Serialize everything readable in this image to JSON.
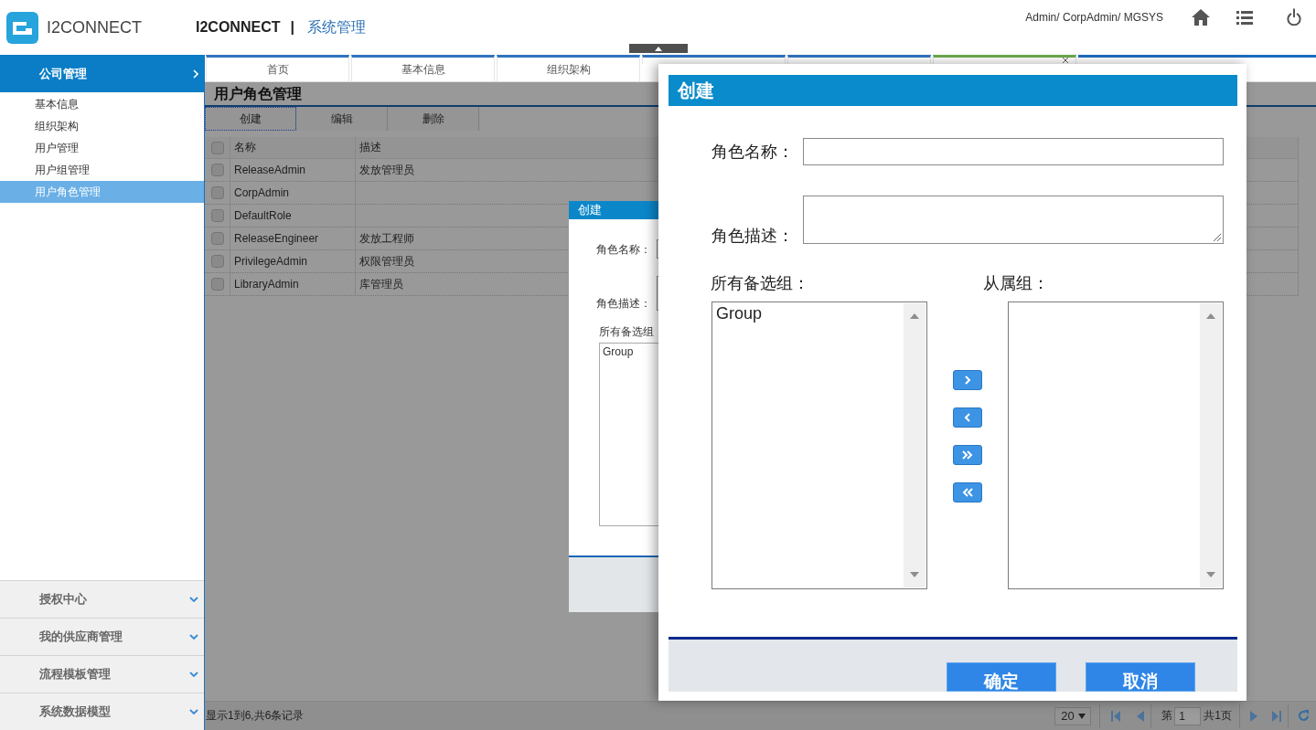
{
  "header": {
    "brand": "I2CONNECT",
    "app": "I2CONNECT",
    "separator": "|",
    "module": "系统管理",
    "user": "Admin/ CorpAdmin/ MGSYS"
  },
  "sidebar": {
    "sections": [
      {
        "label": "公司管理",
        "expanded": true,
        "items": [
          {
            "label": "基本信息",
            "selected": false
          },
          {
            "label": "组织架构",
            "selected": false
          },
          {
            "label": "用户管理",
            "selected": false
          },
          {
            "label": "用户组管理",
            "selected": false
          },
          {
            "label": "用户角色管理",
            "selected": true
          }
        ]
      },
      {
        "label": "授权中心",
        "expanded": false
      },
      {
        "label": "我的供应商管理",
        "expanded": false
      },
      {
        "label": "流程模板管理",
        "expanded": false
      },
      {
        "label": "系统数据模型",
        "expanded": false
      }
    ]
  },
  "tabs": [
    {
      "label": "首页",
      "selected": false,
      "closable": false
    },
    {
      "label": "基本信息",
      "selected": false,
      "closable": false
    },
    {
      "label": "组织架构",
      "selected": false,
      "closable": false
    },
    {
      "selected": false,
      "closable": false
    },
    {
      "selected": false,
      "closable": false
    },
    {
      "selected": true,
      "closable": true
    }
  ],
  "page": {
    "title": "用户角色管理",
    "toolbar": [
      {
        "label": "创建",
        "focused": true
      },
      {
        "label": "编辑",
        "focused": false
      },
      {
        "label": "删除",
        "focused": false
      }
    ],
    "table": {
      "header_checked": false,
      "columns": [
        "名称",
        "描述"
      ],
      "rows": [
        {
          "checked": false,
          "name": "ReleaseAdmin",
          "description": "发放管理员"
        },
        {
          "checked": false,
          "name": "CorpAdmin"
        },
        {
          "checked": false,
          "name": "DefaultRole"
        },
        {
          "checked": false,
          "name": "ReleaseEngineer",
          "description": "发放工程师"
        },
        {
          "checked": false,
          "name": "PrivilegeAdmin",
          "description": "权限管理员"
        },
        {
          "checked": false,
          "name": "LibraryAdmin",
          "description": "库管理员"
        }
      ]
    },
    "footer": {
      "summary": "显示1到6,共6条记录",
      "page_size": "20",
      "page_prefix": "第",
      "page": "1",
      "page_total": "共1页"
    }
  },
  "background_dialog": {
    "title": "创建",
    "fields": [
      {
        "label": "角色名称：",
        "kind": "input"
      },
      {
        "label": "角色描述：",
        "kind": "textarea"
      }
    ],
    "available_label": "所有备选组",
    "available": [
      "Group"
    ]
  },
  "dialog": {
    "title": "创建",
    "fields": [
      {
        "label": "角色名称：",
        "kind": "input"
      },
      {
        "label": "角色描述：",
        "kind": "textarea"
      }
    ],
    "available_label": "所有备选组：",
    "available": [
      "Group"
    ],
    "member_label": "从属组：",
    "buttons": [
      "确定",
      "取消"
    ]
  }
}
